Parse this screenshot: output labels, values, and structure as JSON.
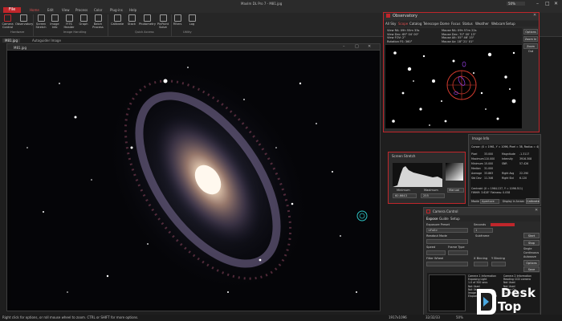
{
  "app": {
    "title": "MaxIm DL Pro 7 - M81.jpg",
    "zoom": "50%"
  },
  "menu": {
    "file": "File",
    "items": [
      "Home",
      "Edit",
      "View",
      "Process",
      "Color",
      "Plug-ins",
      "Help"
    ]
  },
  "ribbon": {
    "buttons": [
      "Camera Control",
      "Observatory",
      "Screen Stretch",
      "Image Info",
      "FITS Header",
      "Graph",
      "Batch Process",
      "Calibrate",
      "Stack",
      "Photometry",
      "PinPoint Solve",
      "Filters",
      "Log"
    ],
    "groups": [
      "Hardware",
      "Image Handling",
      "Quick Access",
      "Utility"
    ]
  },
  "doc_tabs": [
    "M81.jpg",
    "Autoguider Image"
  ],
  "image_window": {
    "title": "M81.jpg"
  },
  "observatory": {
    "title": "Observatory",
    "tabs": [
      "All Sky",
      "Scope",
      "Catalog",
      "Telescope",
      "Dome",
      "Focus",
      "Status",
      "Weather",
      "Webcam",
      "Setup"
    ],
    "info_left": [
      "View RA: 09h 55m 33s",
      "View Dec: 69° 04' 00\"",
      "View FOV: 2°",
      "Rotation FS: 360°"
    ],
    "info_right": [
      "Mouse RA: 09h 57m 22s",
      "Mouse Dec: 70° 00' 13\"",
      "Mouse Alt: 55° 46' 15\"",
      "Mouse Az: 18° 21' 01\""
    ],
    "buttons": [
      "Options",
      "Zoom In",
      "Zoom Out"
    ]
  },
  "stretch": {
    "title": "Screen Stretch",
    "min_label": "Minimum",
    "max_label": "Maximum",
    "min_value": "60.6643",
    "max_value": "255",
    "mode": "Manual"
  },
  "image_info": {
    "title": "Image Info",
    "cursor": "Cursor: (X = 1961, Y = 1096, Pixel = 38, Radius = 4)",
    "rows": [
      [
        "Pixel",
        "33.000",
        "Magnitude",
        "-1.3117"
      ],
      [
        "Maximum",
        "110.000",
        "Intensity",
        "3916.308"
      ],
      [
        "Minimum",
        "15.000",
        "SNR",
        "57.426"
      ],
      [
        "Median",
        "31.000",
        "",
        ""
      ],
      [
        "Average",
        "33.863",
        "Right Avg",
        "22.290"
      ],
      [
        "Std Dev",
        "11.346",
        "Right Std",
        "6.120"
      ]
    ],
    "centroid": "Centroid: (X = 1964.137, Y = 1096.511)",
    "fwhm": "FWHM: 3.628\"   Flatness: 0.058",
    "mode_label": "Mode",
    "mode_value": "Aperture",
    "display_label": "Display in Arcsec",
    "calibrate": "Calibrate"
  },
  "camera": {
    "title": "Camera Control",
    "tabs": [
      "Expose",
      "Guide",
      "Setup"
    ],
    "exposure_preset_label": "Exposure Preset",
    "exposure_preset": "<Full>",
    "seconds_label": "Seconds",
    "seconds_value": "1",
    "readout_label": "Readout Mode",
    "speed_label": "Speed",
    "frame_type_label": "Frame Type",
    "filter_wheel_label": "Filter Wheel",
    "binning_x": "X Binning",
    "binning_y": "Y Binning",
    "subframe_label": "Subframe",
    "start": "Start",
    "stop": "Stop",
    "single": "Single",
    "continuous": "Continuous",
    "autosave": "Autosave",
    "options": "Options",
    "save": "Save",
    "log_left": [
      "Camera 1 Information",
      "Exposing Light",
      "1.0 of 300 secs",
      "Not Used",
      "Not Used"
    ],
    "log_right": [
      "Camera 2 Information",
      "Reading CCD camera",
      "Not Used",
      "Not Used"
    ],
    "log_bottom": [
      "Image 1 of 40",
      "Elapsed 0:00 of 3:03:3"
    ],
    "cooler": [
      "Cooler On",
      "Cooler On"
    ]
  },
  "status": {
    "left": "Right click for options, or roll mouse wheel to zoom. CTRL or SHIFT for more options.",
    "coords": "1917x1096",
    "pixel": "32/32/33",
    "zoom": "50%"
  },
  "watermark": {
    "line1": "Desk",
    "line2": "Top"
  },
  "colors": {
    "accent": "#c0262b",
    "ribbon": "#262626",
    "panel": "#2a2a2a"
  }
}
